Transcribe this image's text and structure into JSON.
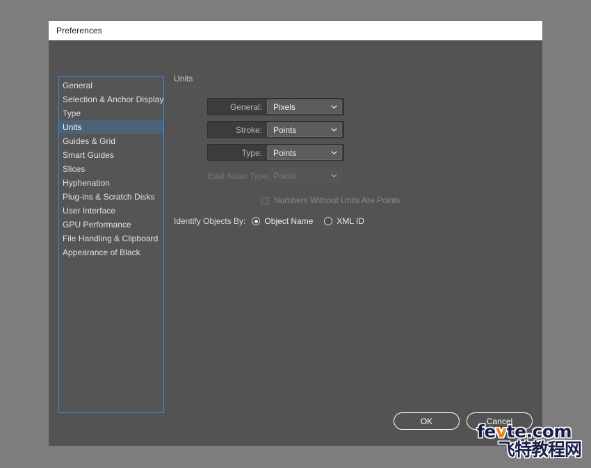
{
  "window": {
    "title": "Preferences"
  },
  "colors": {
    "dialog_bg": "#535353",
    "desktop_bg": "#7d7d7d",
    "titlebar_bg": "#ffffff",
    "list_border_focus": "#2f8fe6",
    "list_selected_bg": "#4c6377",
    "select_bg": "#5c5c5c",
    "watermark_navy": "#1a1f4a",
    "watermark_orange": "#ef7d1a"
  },
  "sidebar": {
    "selected_index": 3,
    "items": [
      {
        "label": "General"
      },
      {
        "label": "Selection & Anchor Display"
      },
      {
        "label": "Type"
      },
      {
        "label": "Units"
      },
      {
        "label": "Guides & Grid"
      },
      {
        "label": "Smart Guides"
      },
      {
        "label": "Slices"
      },
      {
        "label": "Hyphenation"
      },
      {
        "label": "Plug-ins & Scratch Disks"
      },
      {
        "label": "User Interface"
      },
      {
        "label": "GPU Performance"
      },
      {
        "label": "File Handling & Clipboard"
      },
      {
        "label": "Appearance of Black"
      }
    ]
  },
  "panel": {
    "heading": "Units",
    "unit_rows": [
      {
        "label": "General:",
        "value": "Pixels",
        "enabled": true,
        "icon": "chevron-down-icon"
      },
      {
        "label": "Stroke:",
        "value": "Points",
        "enabled": true,
        "icon": "chevron-down-icon"
      },
      {
        "label": "Type:",
        "value": "Points",
        "enabled": true,
        "icon": "chevron-down-icon"
      },
      {
        "label": "East Asian Type:",
        "value": "Points",
        "enabled": false,
        "icon": "chevron-down-icon"
      }
    ],
    "checkbox": {
      "label": "Numbers Without Units Are Points",
      "checked": false,
      "enabled": false
    },
    "identify_objects": {
      "label": "Identify Objects By:",
      "options": [
        {
          "label": "Object Name",
          "selected": true
        },
        {
          "label": "XML ID",
          "selected": false
        }
      ]
    }
  },
  "footer": {
    "ok_label": "OK",
    "cancel_label": "Cancel"
  },
  "watermark": {
    "latin_before": "fe",
    "latin_accent": "v",
    "latin_after": "te.com",
    "chinese": "飞特教程网"
  }
}
